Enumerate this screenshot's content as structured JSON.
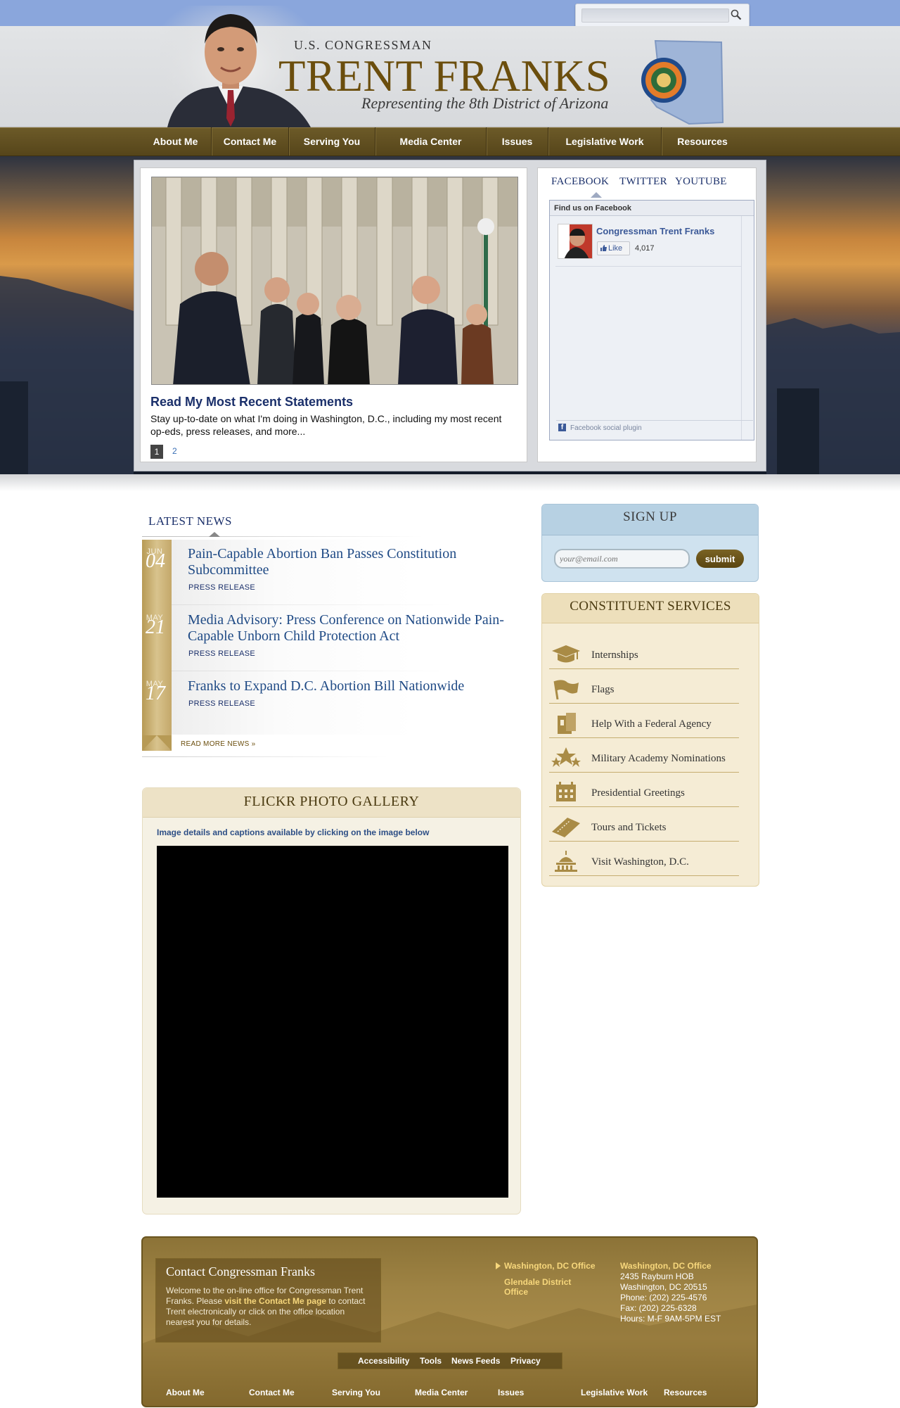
{
  "search": {
    "placeholder": ""
  },
  "header": {
    "pre_title": "U.S. CONGRESSMAN",
    "name": "TRENT FRANKS",
    "tagline": "Representing the 8th District of Arizona"
  },
  "nav": {
    "items": [
      {
        "label": "About Me"
      },
      {
        "label": "Contact Me"
      },
      {
        "label": "Serving You"
      },
      {
        "label": "Media Center"
      },
      {
        "label": "Issues"
      },
      {
        "label": "Legislative Work"
      },
      {
        "label": "Resources"
      }
    ]
  },
  "slideshow": {
    "title": "Read My Most Recent Statements",
    "text": "Stay up-to-date on what I'm doing in Washington, D.C., including my most recent op-eds, press releases, and more...",
    "pages": [
      "1",
      "2"
    ]
  },
  "social": {
    "tabs": [
      "FACEBOOK",
      "TWITTER",
      "YOUTUBE"
    ],
    "facebook": {
      "header": "Find us on Facebook",
      "page_name": "Congressman Trent Franks",
      "like_label": "Like",
      "like_count": "4,017",
      "footer": "Facebook social plugin"
    }
  },
  "news": {
    "heading": "LATEST NEWS",
    "items": [
      {
        "month": "JUN",
        "day": "04",
        "title": "Pain-Capable Abortion Ban Passes Constitution Subcommittee",
        "type": "PRESS RELEASE"
      },
      {
        "month": "MAY",
        "day": "21",
        "title": "Media Advisory: Press Conference on Nationwide Pain-Capable Unborn Child Protection Act",
        "type": "PRESS RELEASE"
      },
      {
        "month": "MAY",
        "day": "17",
        "title": "Franks to Expand D.C. Abortion Bill Nationwide",
        "type": "PRESS RELEASE"
      }
    ],
    "read_more": "READ MORE NEWS »"
  },
  "flickr": {
    "title": "FLICKR PHOTO GALLERY",
    "info": "Image details and captions available by clicking on the image below"
  },
  "signup": {
    "title": "SIGN UP",
    "placeholder": "your@email.com",
    "button": "submit"
  },
  "services": {
    "title": "CONSTITUENT SERVICES",
    "items": [
      {
        "label": "Internships",
        "icon": "graduation-cap-icon"
      },
      {
        "label": "Flags",
        "icon": "flag-icon"
      },
      {
        "label": "Help With a Federal Agency",
        "icon": "folder-icon"
      },
      {
        "label": "Military Academy Nominations",
        "icon": "stars-icon"
      },
      {
        "label": "Presidential Greetings",
        "icon": "calendar-icon"
      },
      {
        "label": "Tours and Tickets",
        "icon": "ticket-icon"
      },
      {
        "label": "Visit Washington, D.C.",
        "icon": "capitol-icon"
      }
    ]
  },
  "footer": {
    "contact_title": "Contact Congressman Franks",
    "contact_text_1": "Welcome to the on-line office for Congressman Trent Franks. Please ",
    "contact_link": "visit the Contact Me page",
    "contact_text_2": " to contact Trent electronically or click on the office location nearest you for details.",
    "offices": [
      "Washington, DC Office",
      "Glendale District Office"
    ],
    "address": {
      "heading": "Washington, DC Office",
      "line1": "2435 Rayburn HOB",
      "line2": "Washington, DC 20515",
      "phone": "Phone: (202) 225-4576",
      "fax": "Fax: (202) 225-6328",
      "hours": "Hours: M-F 9AM-5PM EST"
    },
    "utility_links": [
      "Accessibility",
      "Tools",
      "News Feeds",
      "Privacy"
    ],
    "nav": [
      "About Me",
      "Contact Me",
      "Serving You",
      "Media Center",
      "Issues",
      "Legislative Work",
      "Resources"
    ]
  },
  "colors": {
    "brand_gold": "#6b4e0d",
    "nav_brown": "#5e4c1e",
    "link_blue": "#1f4a85",
    "topbar_blue": "#8aa6dc"
  }
}
